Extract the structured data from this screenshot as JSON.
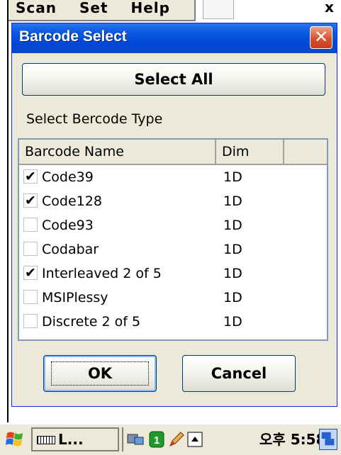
{
  "background": {
    "menu": [
      "Scan",
      "Set",
      "Help"
    ],
    "close_glyph": "x"
  },
  "dialog": {
    "title": "Barcode Select",
    "close_glyph": "✕",
    "select_all_label": "Select All",
    "section_label": "Select Bercode Type",
    "columns": [
      "Barcode Name",
      "Dim",
      ""
    ],
    "rows": [
      {
        "name": "Code39",
        "dim": "1D",
        "checked": true
      },
      {
        "name": "Code128",
        "dim": "1D",
        "checked": true
      },
      {
        "name": "Code93",
        "dim": "1D",
        "checked": false
      },
      {
        "name": "Codabar",
        "dim": "1D",
        "checked": false
      },
      {
        "name": "Interleaved 2 of 5",
        "dim": "1D",
        "checked": true
      },
      {
        "name": "MSIPlessy",
        "dim": "1D",
        "checked": false
      },
      {
        "name": "Discrete 2 of 5",
        "dim": "1D",
        "checked": false
      }
    ],
    "ok_label": "OK",
    "cancel_label": "Cancel"
  },
  "taskbar": {
    "task_label": "L...",
    "clock": "오후 5:58",
    "icons": [
      "start-flag-icon",
      "keyboard-icon",
      "network-icon",
      "numlock-icon",
      "pen-icon",
      "input-panel-icon",
      "desktop-icon"
    ]
  }
}
